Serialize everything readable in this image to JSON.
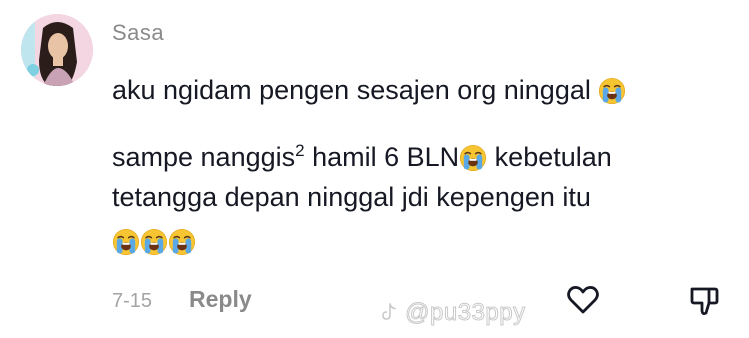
{
  "comment": {
    "username": "Sasa",
    "lines": [
      "aku ngidam pengen sesajen org ninggal",
      "sampe nanggis",
      "2",
      " hamil 6 BLN",
      " kebetulan",
      "tetangga depan ninggal jdi kepengen itu"
    ],
    "emoji_name": "loudly-crying-face",
    "date": "7-15",
    "reply_label": "Reply",
    "watermark": "@pu33ppy"
  },
  "colors": {
    "text": "#161823",
    "muted": "#8a8a8a",
    "date": "#a4a4a4",
    "emoji_face": "#f7c532",
    "emoji_tear": "#5aa9e6"
  }
}
